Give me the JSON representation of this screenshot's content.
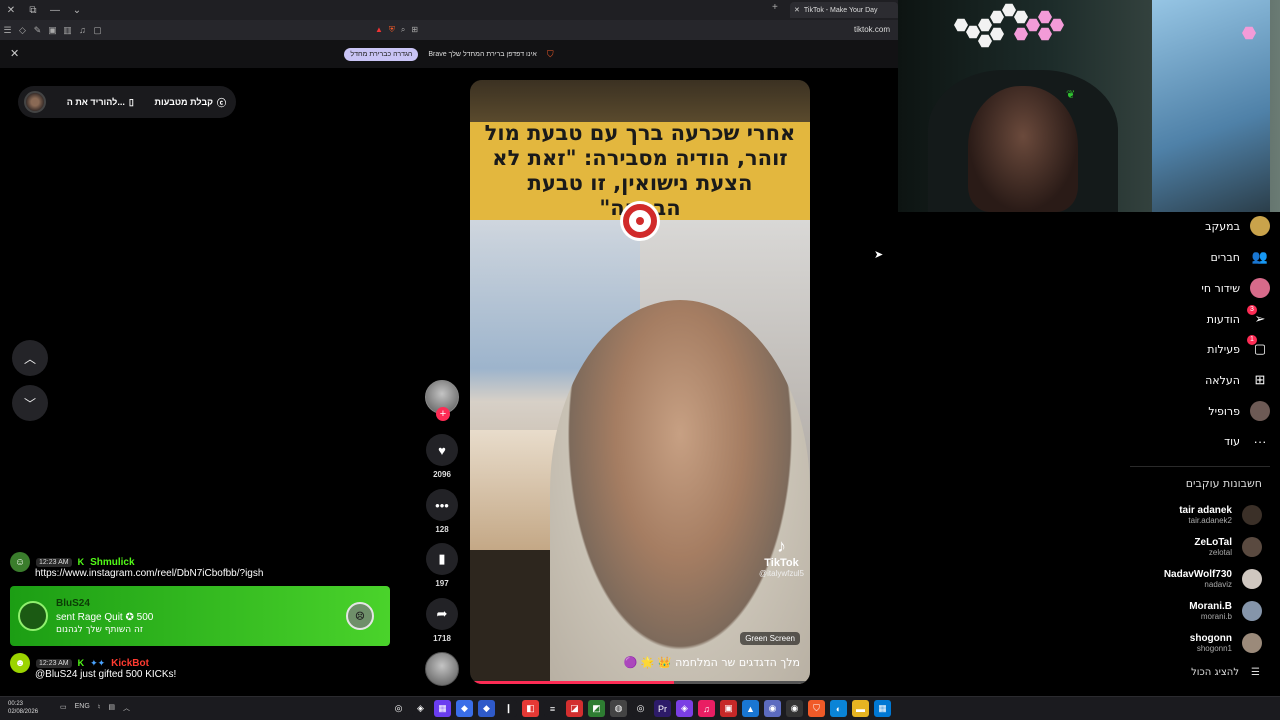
{
  "browser": {
    "tab_title": "TikTok - Make Your Day",
    "url": "tiktok.com",
    "info_message": "Brave אינו דפדפן ברירת המחדל שלך",
    "info_button": "הגדרה כברירת מחדל"
  },
  "tiktok": {
    "top_pill": {
      "get_coins": "קבלת מטבעות",
      "download_app": "להוריד את ה..."
    },
    "video": {
      "headline": "אחרי שכרעה ברך עם טבעת מול זוהר, הודיה מסבירה: \"זאת לא הצעת נישואין, זו טבעת הבטחה\"",
      "tiktok_logo": "TikTok",
      "tiktok_user": "@italywfzul5",
      "green_screen_label": "Green Screen",
      "caption": "מלך הדגדגים שר המלחמה 👑 🌟 🟣",
      "progress": 0.6
    },
    "actions": {
      "likes": "2096",
      "comments": "128",
      "saves": "197",
      "shares": "1718"
    },
    "sidebar": {
      "items": [
        {
          "label": "במעקב",
          "icon": "following-avatar-icon"
        },
        {
          "label": "חברים",
          "icon": "friends-icon"
        },
        {
          "label": "שידור חי",
          "icon": "live-icon"
        },
        {
          "label": "הודעות",
          "icon": "messages-icon",
          "badge": "3"
        },
        {
          "label": "פעילות",
          "icon": "activity-icon",
          "badge": "1"
        },
        {
          "label": "העלאה",
          "icon": "upload-icon"
        },
        {
          "label": "פרופיל",
          "icon": "profile-icon"
        },
        {
          "label": "עוד",
          "icon": "more-icon"
        }
      ],
      "following_title": "חשבונות עוקבים",
      "accounts": [
        {
          "name": "tair adanek",
          "handle": "tair.adanek2",
          "color": "#3b3028"
        },
        {
          "name": "ZeLoTal",
          "handle": "zelotal",
          "color": "#5a4a40"
        },
        {
          "name": "NadavWolf730",
          "handle": "nadaviz",
          "color": "#cfc7c0"
        },
        {
          "name": "Morani.B",
          "handle": "morani.b",
          "color": "#8595aa"
        },
        {
          "name": "shogonn",
          "handle": "shogonn1",
          "color": "#9b8a7a"
        }
      ],
      "show_all": "להציג הכול"
    }
  },
  "chat": {
    "msg1": {
      "time": "12:23 AM",
      "user": "Shmulick",
      "text": "https://www.instagram.com/reel/DbN7iCbofbb/?igsh"
    },
    "gift": {
      "user": "BluS24",
      "line": "sent Rage Quit",
      "amount": "500",
      "sub": "זה השותף שלך לגהנום"
    },
    "msg2": {
      "time": "12:23 AM",
      "user": "KickBot",
      "text": "@BluS24 just gifted 500 KICKs!"
    }
  },
  "taskbar": {
    "time": "00:23",
    "date": "02/08/2026",
    "lang": "ENG"
  }
}
